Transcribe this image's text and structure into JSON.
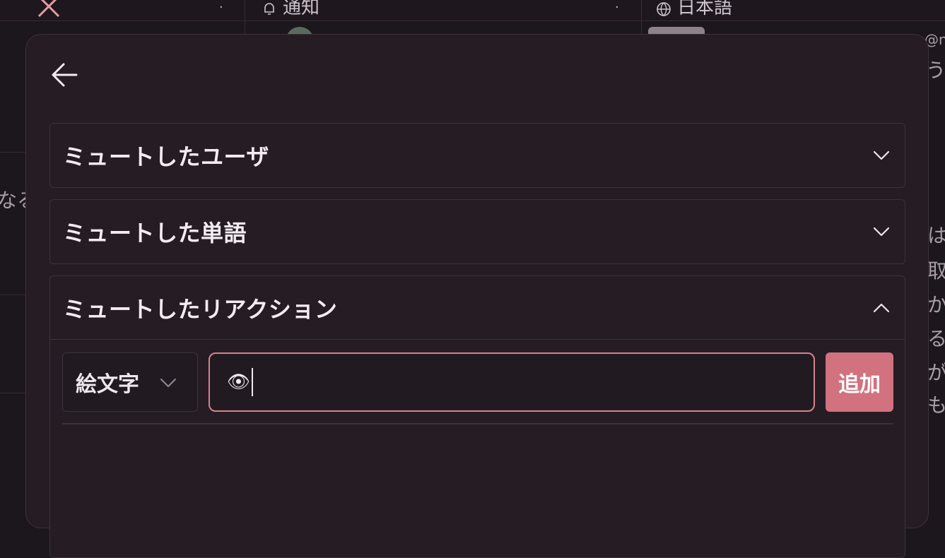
{
  "background": {
    "columns": [
      {
        "title": "通知"
      },
      {
        "title": "日本語"
      }
    ],
    "fragments": [
      "なる",
      "@n",
      "う",
      "は",
      "取",
      "か",
      "る",
      "が",
      "も"
    ]
  },
  "modal": {
    "back_icon": "arrow-left-icon",
    "sections": [
      {
        "title": "ミュートしたユーザ",
        "expanded": false
      },
      {
        "title": "ミュートした単語",
        "expanded": false
      },
      {
        "title": "ミュートしたリアクション",
        "expanded": true
      }
    ],
    "reaction_form": {
      "type_select": "絵文字",
      "input_value": "👁",
      "add_label": "追加"
    }
  },
  "colors": {
    "accent": "#d2727f",
    "focus_border": "#d9828e",
    "panel": "#251c24",
    "border": "#3d323c"
  }
}
